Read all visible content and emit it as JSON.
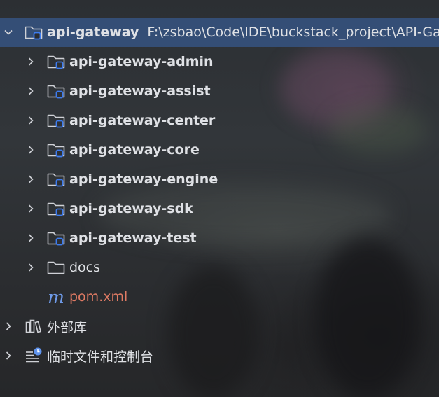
{
  "project": {
    "name": "api-gateway",
    "path": "F:\\zsbao\\Code\\IDE\\buckstack_project\\API-Ga"
  },
  "modules": [
    {
      "label": "api-gateway-admin"
    },
    {
      "label": "api-gateway-assist"
    },
    {
      "label": "api-gateway-center"
    },
    {
      "label": "api-gateway-core"
    },
    {
      "label": "api-gateway-engine"
    },
    {
      "label": "api-gateway-sdk"
    },
    {
      "label": "api-gateway-test"
    }
  ],
  "folders": [
    {
      "label": "docs"
    }
  ],
  "files": [
    {
      "label": "pom.xml",
      "icon": "maven-m-icon",
      "icon_glyph": "m"
    }
  ],
  "extra_nodes": [
    {
      "label": "外部库",
      "icon": "external-libraries-icon"
    },
    {
      "label": "临时文件和控制台",
      "icon": "scratches-consoles-icon"
    }
  ],
  "colors": {
    "selection": "#355280",
    "module_badge": "#3d7cf0",
    "maven_text": "#e07b64",
    "maven_icon": "#6f9be8",
    "text": "#dfe1e5"
  }
}
